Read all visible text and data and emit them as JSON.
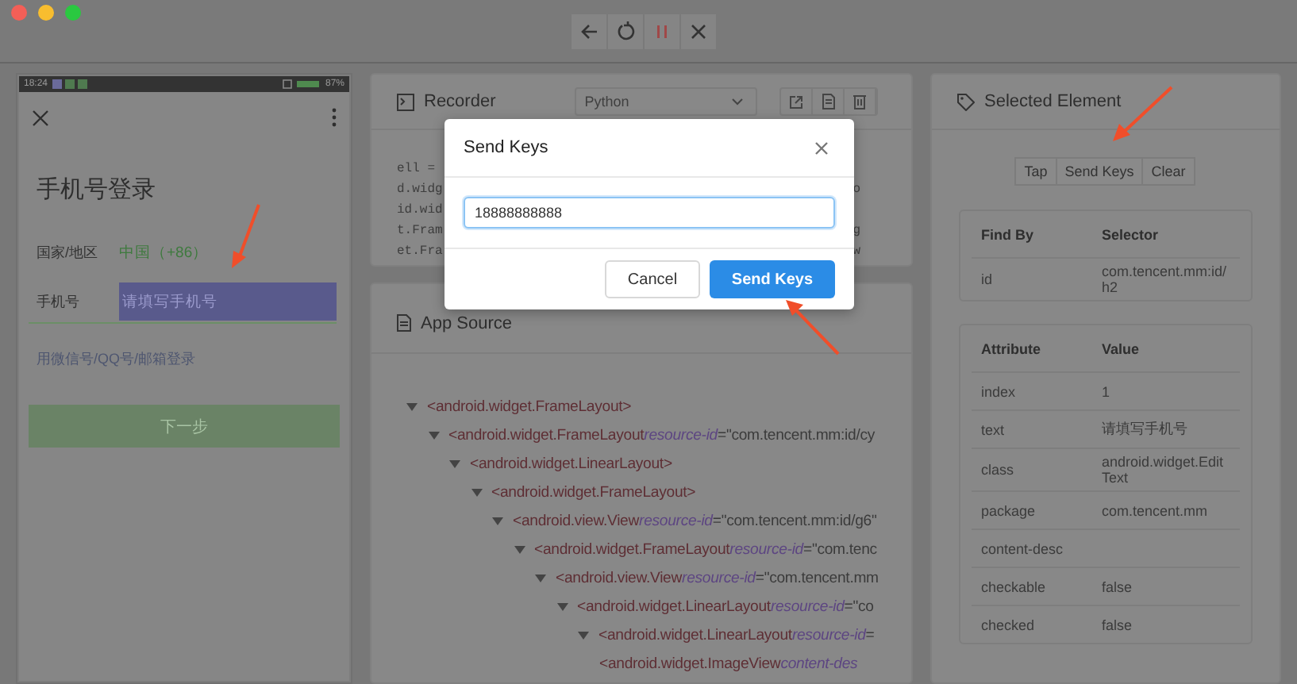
{
  "window": {
    "toolbar": [
      {
        "kind": "back"
      },
      {
        "kind": "refresh"
      },
      {
        "kind": "pause"
      },
      {
        "kind": "close"
      }
    ]
  },
  "device": {
    "status_bar": {
      "time": "18:24",
      "battery": "87%"
    },
    "title": "手机号登录",
    "region_label": "国家/地区",
    "region_value": "中国（+86）",
    "phone_label": "手机号",
    "phone_placeholder": "请填写手机号",
    "alt_login": "用微信号/QQ号/邮箱登录",
    "next_button": "下一步"
  },
  "recorder": {
    "title": "Recorder",
    "language": "Python",
    "code_lines": [
      {
        "left": "ell ="
      },
      {
        "left": "d.widg",
        "right": "o"
      },
      {
        "left": "id.wid"
      },
      {
        "left": "t.Fram",
        "right": "g"
      },
      {
        "left": "et.Fra",
        "right": "w"
      }
    ]
  },
  "app_source": {
    "title": "App Source",
    "tree": [
      {
        "tag": "<android.widget.FrameLayout>",
        "expanded": true,
        "children": [
          {
            "tag": "<android.widget.FrameLayout",
            "attr": "resource-id",
            "value": "=\"com.tencent.mm:id/cy",
            "expanded": true,
            "children": [
              {
                "tag": "<android.widget.LinearLayout>",
                "expanded": true,
                "children": [
                  {
                    "tag": "<android.widget.FrameLayout>",
                    "expanded": true,
                    "children": [
                      {
                        "tag": "<android.view.View",
                        "attr": "resource-id",
                        "value": "=\"com.tencent.mm:id/g6\"",
                        "expanded": true,
                        "children": [
                          {
                            "tag": "<android.widget.FrameLayout",
                            "attr": "resource-id",
                            "value": "=\"com.tenc",
                            "expanded": true,
                            "children": [
                              {
                                "tag": "<android.view.View",
                                "attr": "resource-id",
                                "value": "=\"com.tencent.mm",
                                "expanded": true,
                                "children": [
                                  {
                                    "tag": "<android.widget.LinearLayout",
                                    "attr": "resource-id",
                                    "value": "=\"co",
                                    "expanded": true,
                                    "children": [
                                      {
                                        "tag": "<android.widget.LinearLayout",
                                        "attr": "resource-id",
                                        "value": "=",
                                        "expanded": true,
                                        "children": [
                                          {
                                            "tag": "<android.widget.ImageView",
                                            "attr": "content-des"
                                          }
                                        ]
                                      }
                                    ]
                                  }
                                ]
                              }
                            ]
                          }
                        ]
                      }
                    ]
                  }
                ]
              }
            ]
          }
        ]
      }
    ]
  },
  "selected_element": {
    "title": "Selected Element",
    "actions": [
      "Tap",
      "Send Keys",
      "Clear"
    ],
    "find_by": {
      "columns": [
        "Find By",
        "Selector"
      ],
      "rows": [
        {
          "name": "id",
          "value": "com.tencent.mm:id/h2"
        }
      ]
    },
    "attributes": {
      "columns": [
        "Attribute",
        "Value"
      ],
      "rows": [
        {
          "name": "index",
          "value": "1"
        },
        {
          "name": "text",
          "value": "请填写手机号"
        },
        {
          "name": "class",
          "value": "android.widget.EditText"
        },
        {
          "name": "package",
          "value": "com.tencent.mm"
        },
        {
          "name": "content-desc"
        },
        {
          "name": "checkable",
          "value": "false"
        },
        {
          "name": "checked",
          "value": "false"
        }
      ]
    }
  },
  "dialog": {
    "title": "Send Keys",
    "value": "18888888888",
    "cancel": "Cancel",
    "confirm": "Send Keys"
  }
}
